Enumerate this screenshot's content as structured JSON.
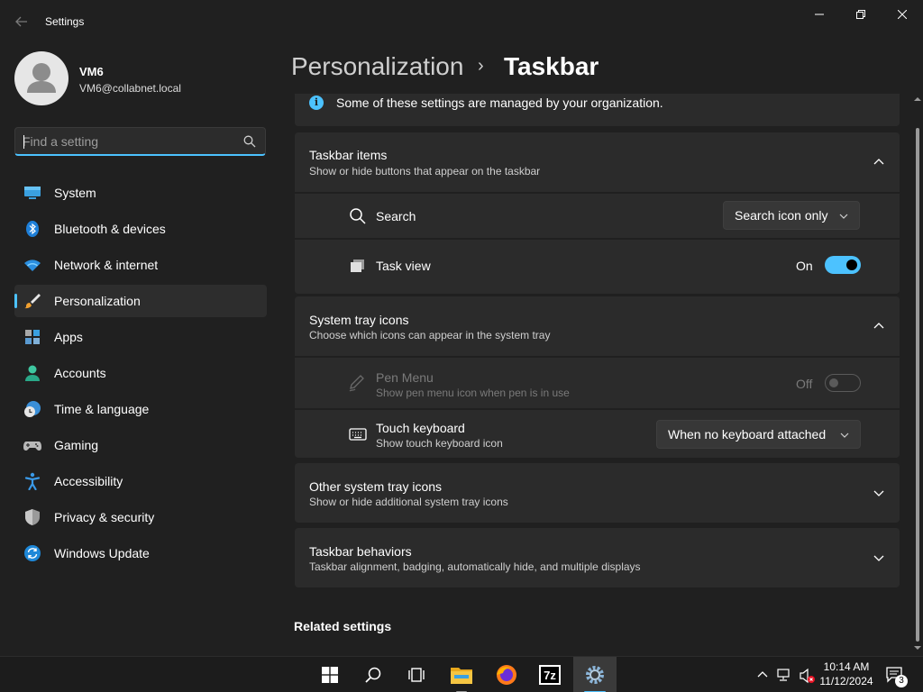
{
  "window": {
    "title": "Settings",
    "back_icon": "back-arrow-icon",
    "controls": [
      "minimize-icon",
      "restore-icon",
      "close-icon"
    ]
  },
  "profile": {
    "name": "VM6",
    "email": "VM6@collabnet.local"
  },
  "search": {
    "placeholder": "Find a setting",
    "value": ""
  },
  "nav": {
    "items": [
      {
        "label": "System",
        "icon": "system-icon"
      },
      {
        "label": "Bluetooth & devices",
        "icon": "bluetooth-icon"
      },
      {
        "label": "Network & internet",
        "icon": "wifi-icon"
      },
      {
        "label": "Personalization",
        "icon": "brush-icon",
        "selected": true
      },
      {
        "label": "Apps",
        "icon": "apps-icon"
      },
      {
        "label": "Accounts",
        "icon": "accounts-icon"
      },
      {
        "label": "Time & language",
        "icon": "clock-globe-icon"
      },
      {
        "label": "Gaming",
        "icon": "gamepad-icon"
      },
      {
        "label": "Accessibility",
        "icon": "accessibility-icon"
      },
      {
        "label": "Privacy & security",
        "icon": "shield-icon"
      },
      {
        "label": "Windows Update",
        "icon": "update-icon"
      }
    ]
  },
  "header": {
    "parent": "Personalization",
    "separator": "›",
    "title": "Taskbar"
  },
  "notice": {
    "icon": "info-icon",
    "glyph": "i",
    "text": "Some of these settings are managed by your organization."
  },
  "sections": {
    "taskbar_items": {
      "title": "Taskbar items",
      "desc": "Show or hide buttons that appear on the taskbar",
      "expanded": true,
      "search": {
        "label": "Search",
        "value": "Search icon only"
      },
      "task_view": {
        "label": "Task view",
        "state": "On"
      }
    },
    "system_tray": {
      "title": "System tray icons",
      "desc": "Choose which icons can appear in the system tray",
      "expanded": true,
      "pen_menu": {
        "label": "Pen Menu",
        "desc": "Show pen menu icon when pen is in use",
        "state": "Off",
        "disabled": true
      },
      "touch_keyboard": {
        "label": "Touch keyboard",
        "desc": "Show touch keyboard icon",
        "value": "When no keyboard attached"
      }
    },
    "other_tray": {
      "title": "Other system tray icons",
      "desc": "Show or hide additional system tray icons",
      "expanded": false
    },
    "behaviors": {
      "title": "Taskbar behaviors",
      "desc": "Taskbar alignment, badging, automatically hide, and multiple displays",
      "expanded": false
    }
  },
  "related": {
    "title": "Related settings"
  },
  "taskbar": {
    "apps": [
      "start-icon",
      "search-icon",
      "task-view-icon",
      "file-explorer-icon",
      "firefox-icon",
      "7zip-icon",
      "settings-icon"
    ],
    "active_app": "settings-icon",
    "sevenzip_label": "7z",
    "time": "10:14 AM",
    "date": "11/12/2024",
    "notification_count": "3"
  },
  "colors": {
    "accent": "#4cc2ff",
    "background": "#202020",
    "card": "#2b2b2b"
  }
}
